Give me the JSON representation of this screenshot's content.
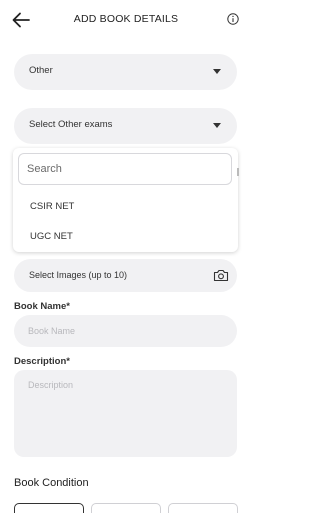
{
  "header": {
    "title": "ADD BOOK DETAILS",
    "back_icon": "arrow-left-icon",
    "info_icon": "info-icon"
  },
  "category_select": {
    "value": "Other"
  },
  "exam_select": {
    "value": "Select Other exams",
    "search_placeholder": "Search",
    "options": [
      "CSIR NET",
      "UGC NET"
    ]
  },
  "images": {
    "label": "Select Images (up to 10)",
    "icon": "camera-icon"
  },
  "book_name": {
    "label": "Book Name*",
    "placeholder": "Book Name"
  },
  "description": {
    "label": "Description*",
    "placeholder": "Description"
  },
  "book_condition": {
    "title": "Book Condition"
  },
  "colors": {
    "pill_background": "#f1f1f3",
    "text": "#333333",
    "placeholder": "#b8b8bc",
    "selected_border": "#333333"
  }
}
